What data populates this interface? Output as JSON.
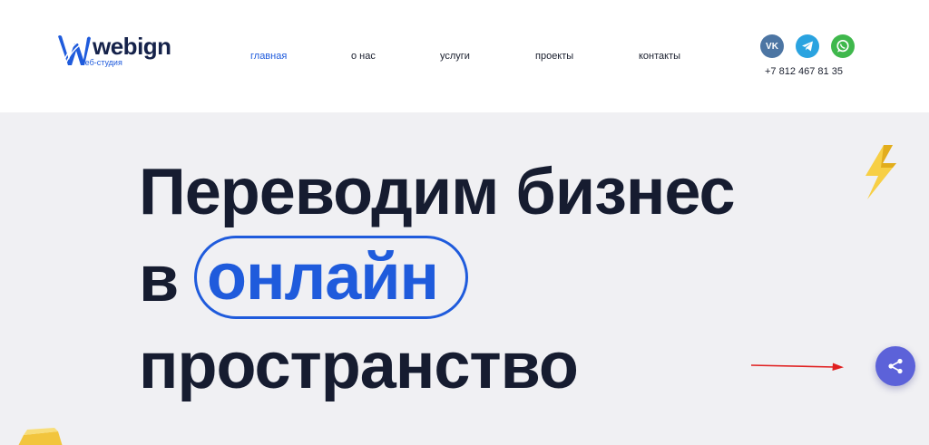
{
  "brand": {
    "name": "webign",
    "tagline": "веб-студия",
    "icon": "stylized-w-logo-icon",
    "color": "#1f5bdc"
  },
  "nav": {
    "items": [
      {
        "label": "главная",
        "active": true
      },
      {
        "label": "о нас",
        "active": false
      },
      {
        "label": "услуги",
        "active": false
      },
      {
        "label": "проекты",
        "active": false
      },
      {
        "label": "контакты",
        "active": false
      }
    ]
  },
  "contacts": {
    "socials": [
      {
        "name": "vk-icon",
        "glyph": "VK",
        "color": "#4c75a3"
      },
      {
        "name": "telegram-icon",
        "color": "#2aa3e0"
      },
      {
        "name": "whatsapp-icon",
        "color": "#3fb84c"
      }
    ],
    "phone": "+7 812 467 81 35"
  },
  "hero": {
    "line1": "Переводим бизнес",
    "line2_prefix": "в",
    "line2_highlight": "онлайн",
    "line3": "пространство",
    "background": "#f0f0f3",
    "heading_color": "#161c30",
    "accent_color": "#1f5bdc"
  },
  "widgets": {
    "share_icon": "share-icon",
    "share_color": "#5c62d9",
    "arrow_color": "#e02020",
    "decor": [
      "lightning-bolt-icon",
      "gold-cube-icon"
    ]
  }
}
